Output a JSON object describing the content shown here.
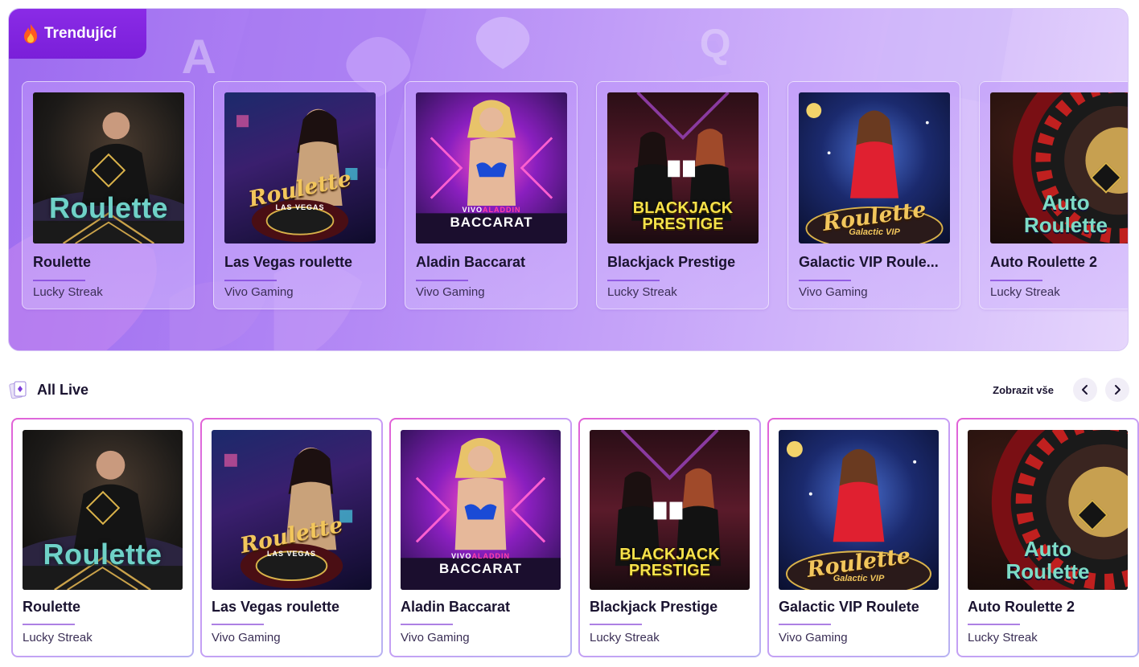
{
  "trending": {
    "label": "Trendující",
    "icon": "flame-icon",
    "cards": [
      {
        "title": "Roulette",
        "provider": "Lucky Streak",
        "art": "roulette"
      },
      {
        "title": "Las Vegas roulette",
        "provider": "Vivo Gaming",
        "art": "lasvegas"
      },
      {
        "title": "Aladin Baccarat",
        "provider": "Vivo Gaming",
        "art": "baccarat"
      },
      {
        "title": "Blackjack Prestige",
        "provider": "Lucky Streak",
        "art": "blackjack"
      },
      {
        "title": "Galactic VIP Roule...",
        "provider": "Vivo Gaming",
        "art": "galactic"
      },
      {
        "title": "Auto Roulette 2",
        "provider": "Lucky Streak",
        "art": "auto"
      }
    ]
  },
  "all_live": {
    "title": "All Live",
    "icon": "cards-icon",
    "show_all": "Zobrazit vše",
    "prev_icon": "chevron-left-icon",
    "next_icon": "chevron-right-icon",
    "cards": [
      {
        "title": "Roulette",
        "provider": "Lucky Streak",
        "art": "roulette"
      },
      {
        "title": "Las Vegas roulette",
        "provider": "Vivo Gaming",
        "art": "lasvegas"
      },
      {
        "title": "Aladin Baccarat",
        "provider": "Vivo Gaming",
        "art": "baccarat"
      },
      {
        "title": "Blackjack Prestige",
        "provider": "Lucky Streak",
        "art": "blackjack"
      },
      {
        "title": "Galactic VIP Roulete",
        "provider": "Vivo Gaming",
        "art": "galactic"
      },
      {
        "title": "Auto Roulette 2",
        "provider": "Lucky Streak",
        "art": "auto"
      }
    ]
  },
  "art_text": {
    "roulette": "Roulette",
    "lasvegas": "Roulette",
    "lasvegas_sub": "LAS VEGAS",
    "vivo": "VIVO",
    "aladin": "ALADDIN",
    "baccarat": "BACCARAT",
    "bj_1": "BLACKJACK",
    "bj_2": "PRESTIGE",
    "galactic": "Roulette",
    "galactic_sub": "Galactic VIP",
    "auto_1": "Auto",
    "auto_2": "Roulette"
  },
  "colors": {
    "badge": "#8a2be6",
    "accent": "#7a3ad8",
    "card_border_from": "#e25fd6",
    "card_border_to": "#b8b2f2"
  }
}
